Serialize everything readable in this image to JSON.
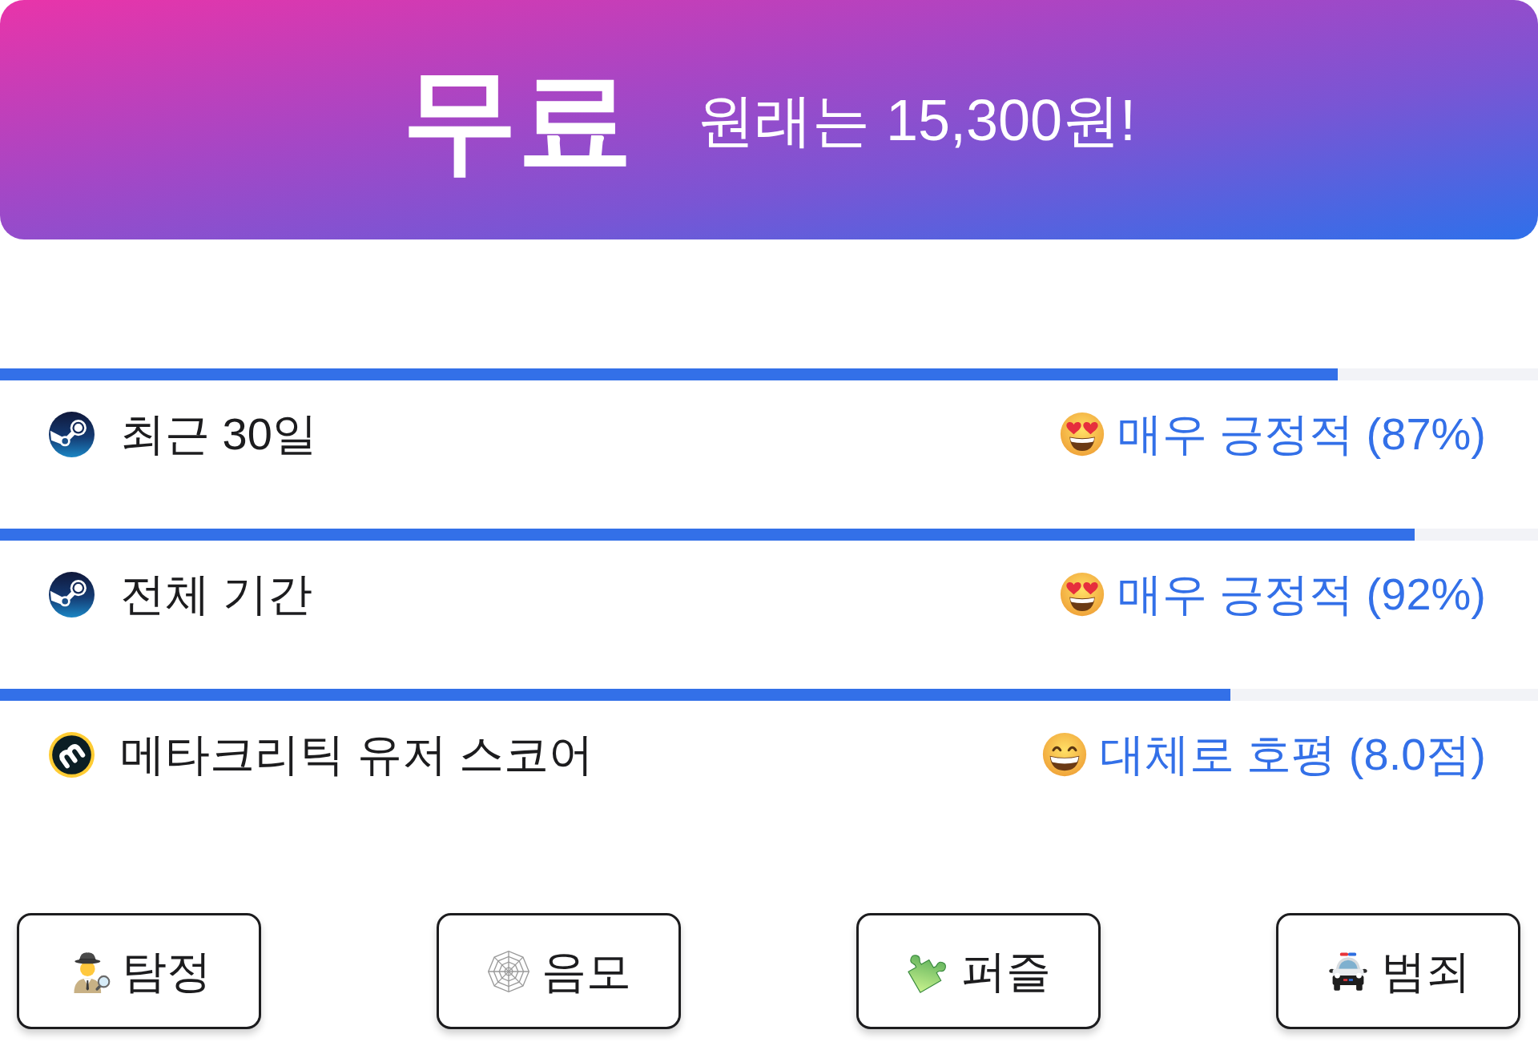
{
  "banner": {
    "price": "무료",
    "note": "원래는 15,300원!"
  },
  "ratings": [
    {
      "kind": "steam",
      "label": "최근 30일",
      "verdict": "매우 긍정적 (87%)",
      "level": 0.87
    },
    {
      "kind": "steam",
      "label": "전체 기간",
      "verdict": "매우 긍정적 (92%)",
      "level": 0.92
    },
    {
      "kind": "metacritic",
      "label": "메타크리틱 유저 스코어",
      "verdict": "대체로 호평 (8.0점)",
      "level": 0.8
    }
  ],
  "tags": [
    {
      "label": "탐정"
    },
    {
      "label": "음모"
    },
    {
      "label": "퍼즐"
    },
    {
      "label": "범죄"
    }
  ]
}
